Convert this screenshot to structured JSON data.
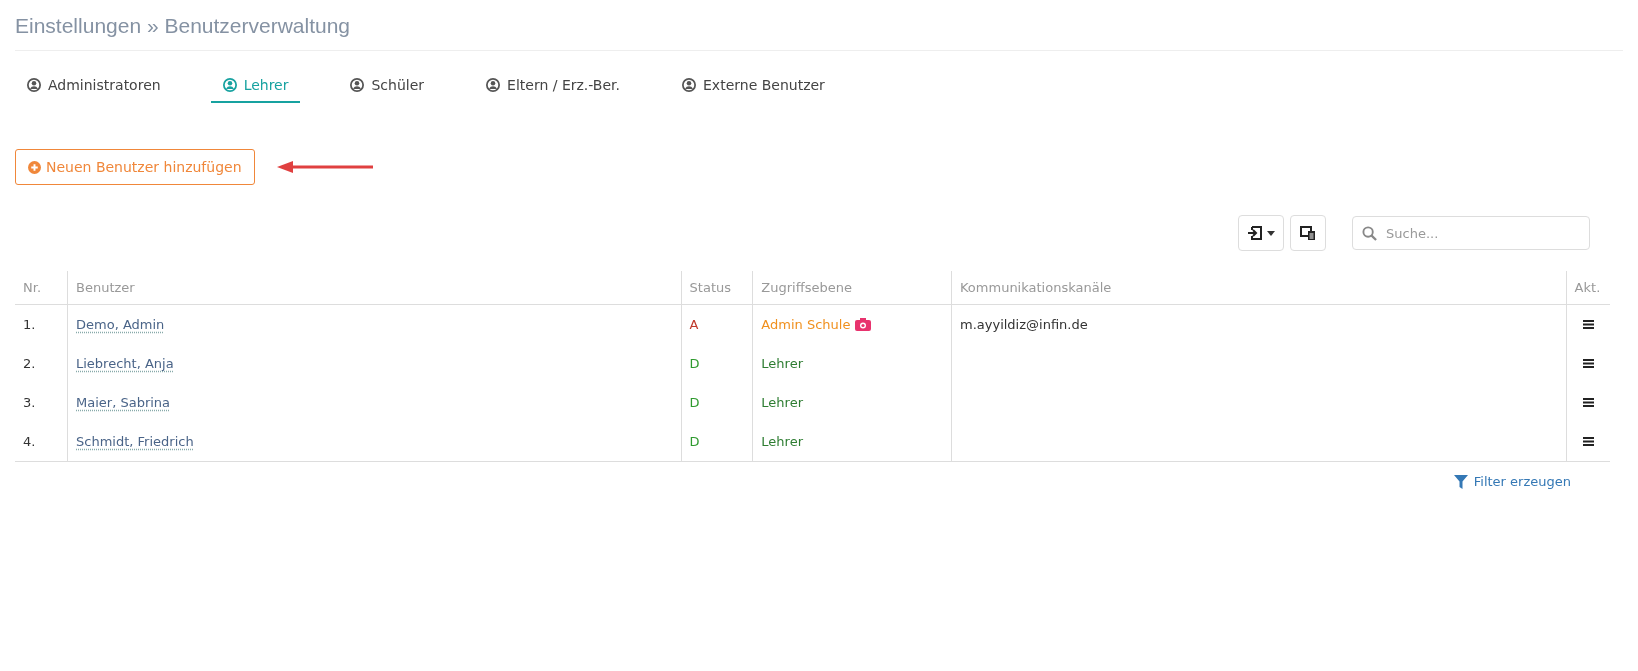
{
  "breadcrumb": "Einstellungen » Benutzerverwaltung",
  "tabs": [
    {
      "label": "Administratoren",
      "selected": false
    },
    {
      "label": "Lehrer",
      "selected": true
    },
    {
      "label": "Schüler",
      "selected": false
    },
    {
      "label": "Eltern / Erz.-Ber.",
      "selected": false
    },
    {
      "label": "Externe Benutzer",
      "selected": false
    }
  ],
  "add_button": "Neuen Benutzer hinzufügen",
  "search": {
    "placeholder": "Suche..."
  },
  "table": {
    "columns": [
      "Nr.",
      "Benutzer",
      "Status",
      "Zugriffsebene",
      "Kommunikationskanäle",
      "Akt."
    ],
    "rows": [
      {
        "nr": "1.",
        "user": "Demo, Admin",
        "status": "A",
        "access": "Admin Schule",
        "kind": "admin",
        "channels": "m.ayyildiz@infin.de"
      },
      {
        "nr": "2.",
        "user": "Liebrecht, Anja",
        "status": "D",
        "access": "Lehrer",
        "kind": "default"
      },
      {
        "nr": "3.",
        "user": "Maier, Sabrina",
        "status": "D",
        "access": "Lehrer",
        "kind": "default"
      },
      {
        "nr": "4.",
        "user": "Schmidt, Friedrich",
        "status": "D",
        "access": "Lehrer",
        "kind": "default"
      }
    ]
  },
  "filter_link": "Filter erzeugen"
}
